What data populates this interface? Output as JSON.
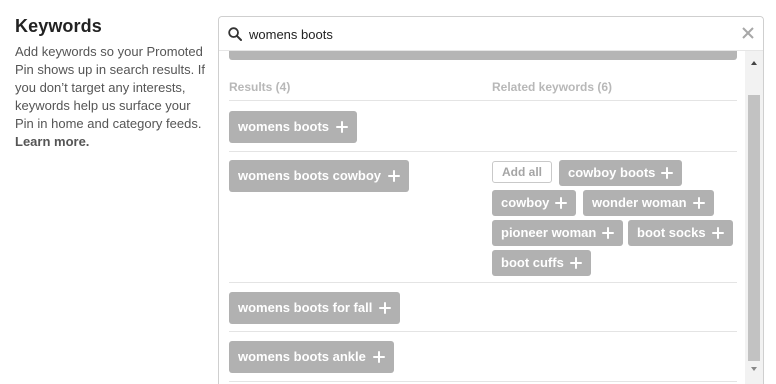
{
  "sidebar": {
    "title": "Keywords",
    "description": "Add keywords so your Promoted Pin shows up in search results. If you don’t target any interests, keywords help us surface your Pin in home and category feeds.",
    "learn_more": "Learn more."
  },
  "search": {
    "value": "womens boots",
    "search_icon": "search-icon",
    "clear_icon": "close-icon"
  },
  "columns": {
    "results": "Results (4)",
    "related": "Related keywords (6)"
  },
  "results": [
    {
      "label": "womens boots"
    },
    {
      "label": "womens boots cowboy"
    },
    {
      "label": "womens boots for fall"
    },
    {
      "label": "womens boots ankle"
    }
  ],
  "related": {
    "add_all": "Add all",
    "items": [
      {
        "label": "cowboy boots"
      },
      {
        "label": "cowboy"
      },
      {
        "label": "wonder woman"
      },
      {
        "label": "pioneer woman"
      },
      {
        "label": "boot socks"
      },
      {
        "label": "boot cuffs"
      }
    ]
  },
  "colors": {
    "pill": "#b1b1b1",
    "pill_text": "#ffffff",
    "header_text": "#b8b8b8"
  }
}
